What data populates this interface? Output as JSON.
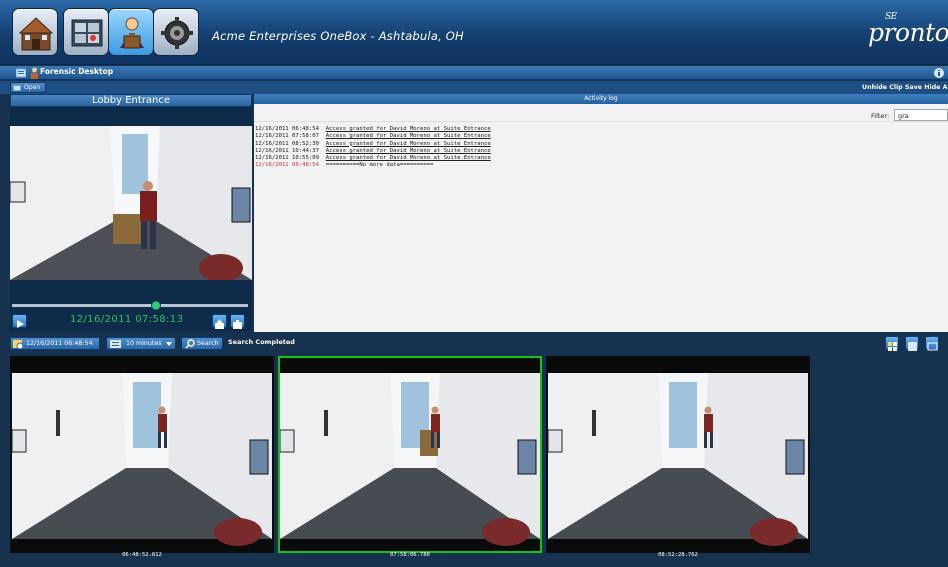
{
  "header": {
    "app_title": "Acme Enterprises OneBox - Ashtabula, OH",
    "logo_text": "pronto",
    "logo_small": "SE",
    "nav_icons": [
      "home-icon",
      "map-icon",
      "forensic-desktop-icon",
      "settings-gear-icon"
    ]
  },
  "desktop": {
    "title": "Forensic Desktop",
    "open_label": "Open",
    "right_links": "Unhide Clip Save  Hide A"
  },
  "video": {
    "camera_name": "Lobby Entrance",
    "timestamp": "12/16/2011 07:58:13"
  },
  "activity_log": {
    "title": "Activity log",
    "filter_label": "Filter:",
    "filter_value": "gra",
    "rows": [
      {
        "time": "12/16/2011 06:48:54",
        "text": "Access granted for David Moreno at Suite Entrance"
      },
      {
        "time": "12/16/2011 07:58:07",
        "text": "Access granted for David Moreno at Suite Entrance"
      },
      {
        "time": "12/16/2011 08:52:30",
        "text": "Access granted for David Moreno at Suite Entrance"
      },
      {
        "time": "12/16/2011 10:44:37",
        "text": "Access granted for David Moreno at Suite Entrance"
      },
      {
        "time": "12/16/2011 10:55:09",
        "text": "Access granted for David Moreno at Suite Entrance"
      }
    ],
    "end_row": {
      "time": "12/16/2011 06:48:54",
      "text": "==========No more data=========="
    }
  },
  "search": {
    "start_time": "12/16/2011 06:48:54",
    "duration": "10 minutes",
    "search_label": "Search",
    "status": "Search Completed"
  },
  "thumbnails": [
    {
      "time": "06:48:52.812",
      "selected": false
    },
    {
      "time": "07:58:06.780",
      "selected": true
    },
    {
      "time": "08:52:28.762",
      "selected": false
    }
  ],
  "colors": {
    "selected_border": "#17c217",
    "timestamp_text": "#27c45e",
    "end_row_text": "#d33333"
  }
}
